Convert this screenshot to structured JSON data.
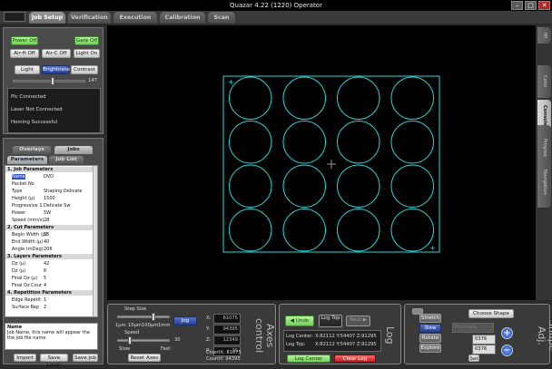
{
  "titlebar": {
    "title": "Quazar 4.22 (1220) Operator",
    "minimize": "–",
    "maximize": "□",
    "close": "✕"
  },
  "tabs": [
    "Job Setup",
    "Verification",
    "Execution",
    "Calibration",
    "Scan"
  ],
  "controls": {
    "power_off": "Power Off",
    "gate_off": "Gate Off",
    "air_h_off": "Air-H Off",
    "air_c_off": "Air-C Off",
    "light_on": "Light On",
    "light": "Light",
    "brightness": "Brightness",
    "contrast": "Contrast",
    "slider_value": "147"
  },
  "status_lines": [
    "Plc Connected",
    "Laser Not Connected",
    "Homing Successful"
  ],
  "param_tabs": [
    "Overlays",
    "Jobs"
  ],
  "param_subtabs": [
    "Parameters",
    "Job List"
  ],
  "parameters": [
    {
      "name": "1. Job Parameters",
      "value": "",
      "category": true
    },
    {
      "name": "Name",
      "value": "DVD",
      "selected": true
    },
    {
      "name": "Packet No",
      "value": ""
    },
    {
      "name": "Type",
      "value": "Shaping Delicate"
    },
    {
      "name": "Height (µ)",
      "value": "1500"
    },
    {
      "name": "Progressive 1",
      "value": "Delicate Sw"
    },
    {
      "name": "Power",
      "value": "5W"
    },
    {
      "name": "Speed (mm/s)",
      "value": "28"
    },
    {
      "name": "2. Cut Parameters",
      "value": "",
      "category": true
    },
    {
      "name": "Begin Width (µ)",
      "value": "55"
    },
    {
      "name": "End Width (µ)",
      "value": "40"
    },
    {
      "name": "Angle (mDeg)",
      "value": "206"
    },
    {
      "name": "3. Layers Parameters",
      "value": "",
      "category": true
    },
    {
      "name": "Dz (µ)",
      "value": "42"
    },
    {
      "name": "Dz (µ)",
      "value": "6"
    },
    {
      "name": "Final Dz (µ)",
      "value": "5"
    },
    {
      "name": "Final Dz Cour",
      "value": "4"
    },
    {
      "name": "4. Repetition Parameters",
      "value": "",
      "category": true
    },
    {
      "name": "Edge Repetit",
      "value": "1"
    },
    {
      "name": "Surface Rep",
      "value": "2"
    }
  ],
  "description": {
    "title": "Name",
    "text": "Job Name, this name will appear the the job file name"
  },
  "left_buttons": [
    "Import",
    "Save Layer",
    "Save Job"
  ],
  "right_tabs": [
    "IM",
    "Color",
    "Consoles",
    "Progress",
    "Navigation"
  ],
  "view": {
    "rows": 4,
    "cols": 4,
    "color": "#2ad8d8"
  },
  "axes": {
    "title": "Axes control",
    "step_size": "Step Size",
    "steps": [
      "1µm",
      "10µm",
      "100µm",
      "1mm"
    ],
    "jog": "Jog",
    "speed": "Speed",
    "slow": "Slow",
    "fast": "Fast",
    "speed_value": "30",
    "reset": "Reset Axes",
    "readouts": [
      {
        "label": "X:",
        "value": "81075"
      },
      {
        "label": "Y:",
        "value": "94395"
      },
      {
        "label": "Z:",
        "value": "12349"
      },
      {
        "label": "R:",
        "value": "35"
      }
    ],
    "count_x": "CountX: 81075",
    "count_y": "CountY: 94395"
  },
  "log": {
    "title": "Log",
    "undo": "Undo",
    "log_top": "Log Top",
    "next": "Next",
    "rows": [
      {
        "label": "Log Center:",
        "value": "X:82112 Y:54407 Z:91295"
      },
      {
        "label": "Log Top:",
        "value": "X:82112 Y:54407 Z:91295"
      }
    ],
    "log_center_btn": "Log Center",
    "clear_log_btn": "Clear Log"
  },
  "shape": {
    "title": "Shape Adj.",
    "choose": "Choose Shape",
    "stretch": "Stretch",
    "slew": "Slew",
    "rotate": "Rotate",
    "explore": "Explore",
    "dropdown": "Eliminate",
    "values": [
      "0376",
      "0376"
    ],
    "set": "Set",
    "plus": "+",
    "minus": "−"
  }
}
